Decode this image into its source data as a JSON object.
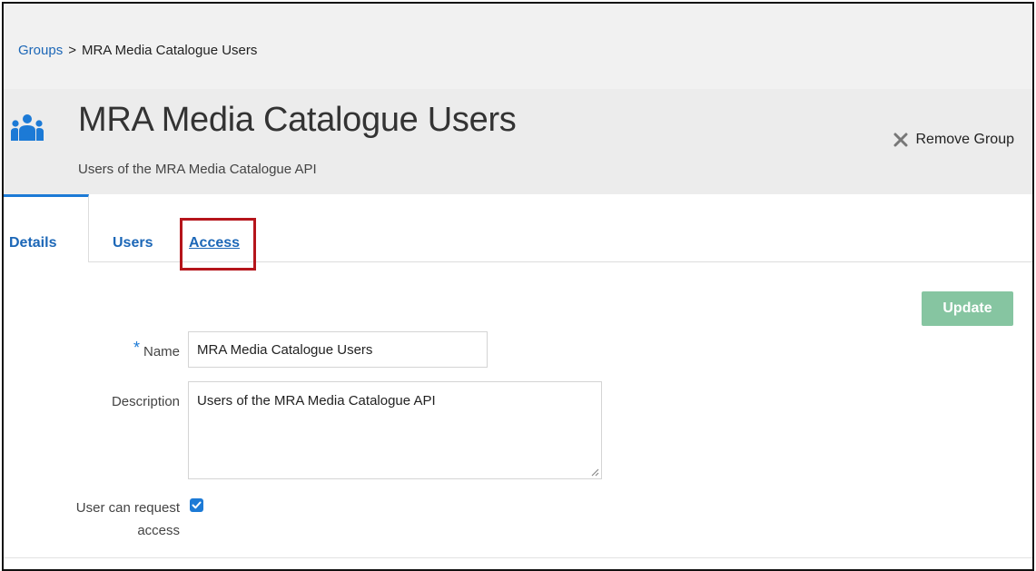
{
  "breadcrumb": {
    "parent": "Groups",
    "separator": ">",
    "current": "MRA Media Catalogue Users"
  },
  "header": {
    "icon": "group-icon",
    "title": "MRA Media Catalogue Users",
    "description": "Users of the MRA Media Catalogue API",
    "remove_label": "Remove Group",
    "remove_icon": "close-icon"
  },
  "tabs": [
    {
      "label": "Details",
      "active": true
    },
    {
      "label": "Users",
      "active": false
    },
    {
      "label": "Access",
      "active": false,
      "highlighted": true
    }
  ],
  "form": {
    "update_label": "Update",
    "required_marker": "*",
    "name_label": "Name",
    "name_value": "MRA Media Catalogue Users",
    "description_label": "Description",
    "description_value": "Users of the MRA Media Catalogue API",
    "request_label_line1": "User can request",
    "request_label_line2": "access",
    "request_checked": true
  },
  "colors": {
    "link": "#1c67b7",
    "accent": "#1c7ad6",
    "update_button": "#86c5a1",
    "highlight_box": "#b5151b"
  }
}
